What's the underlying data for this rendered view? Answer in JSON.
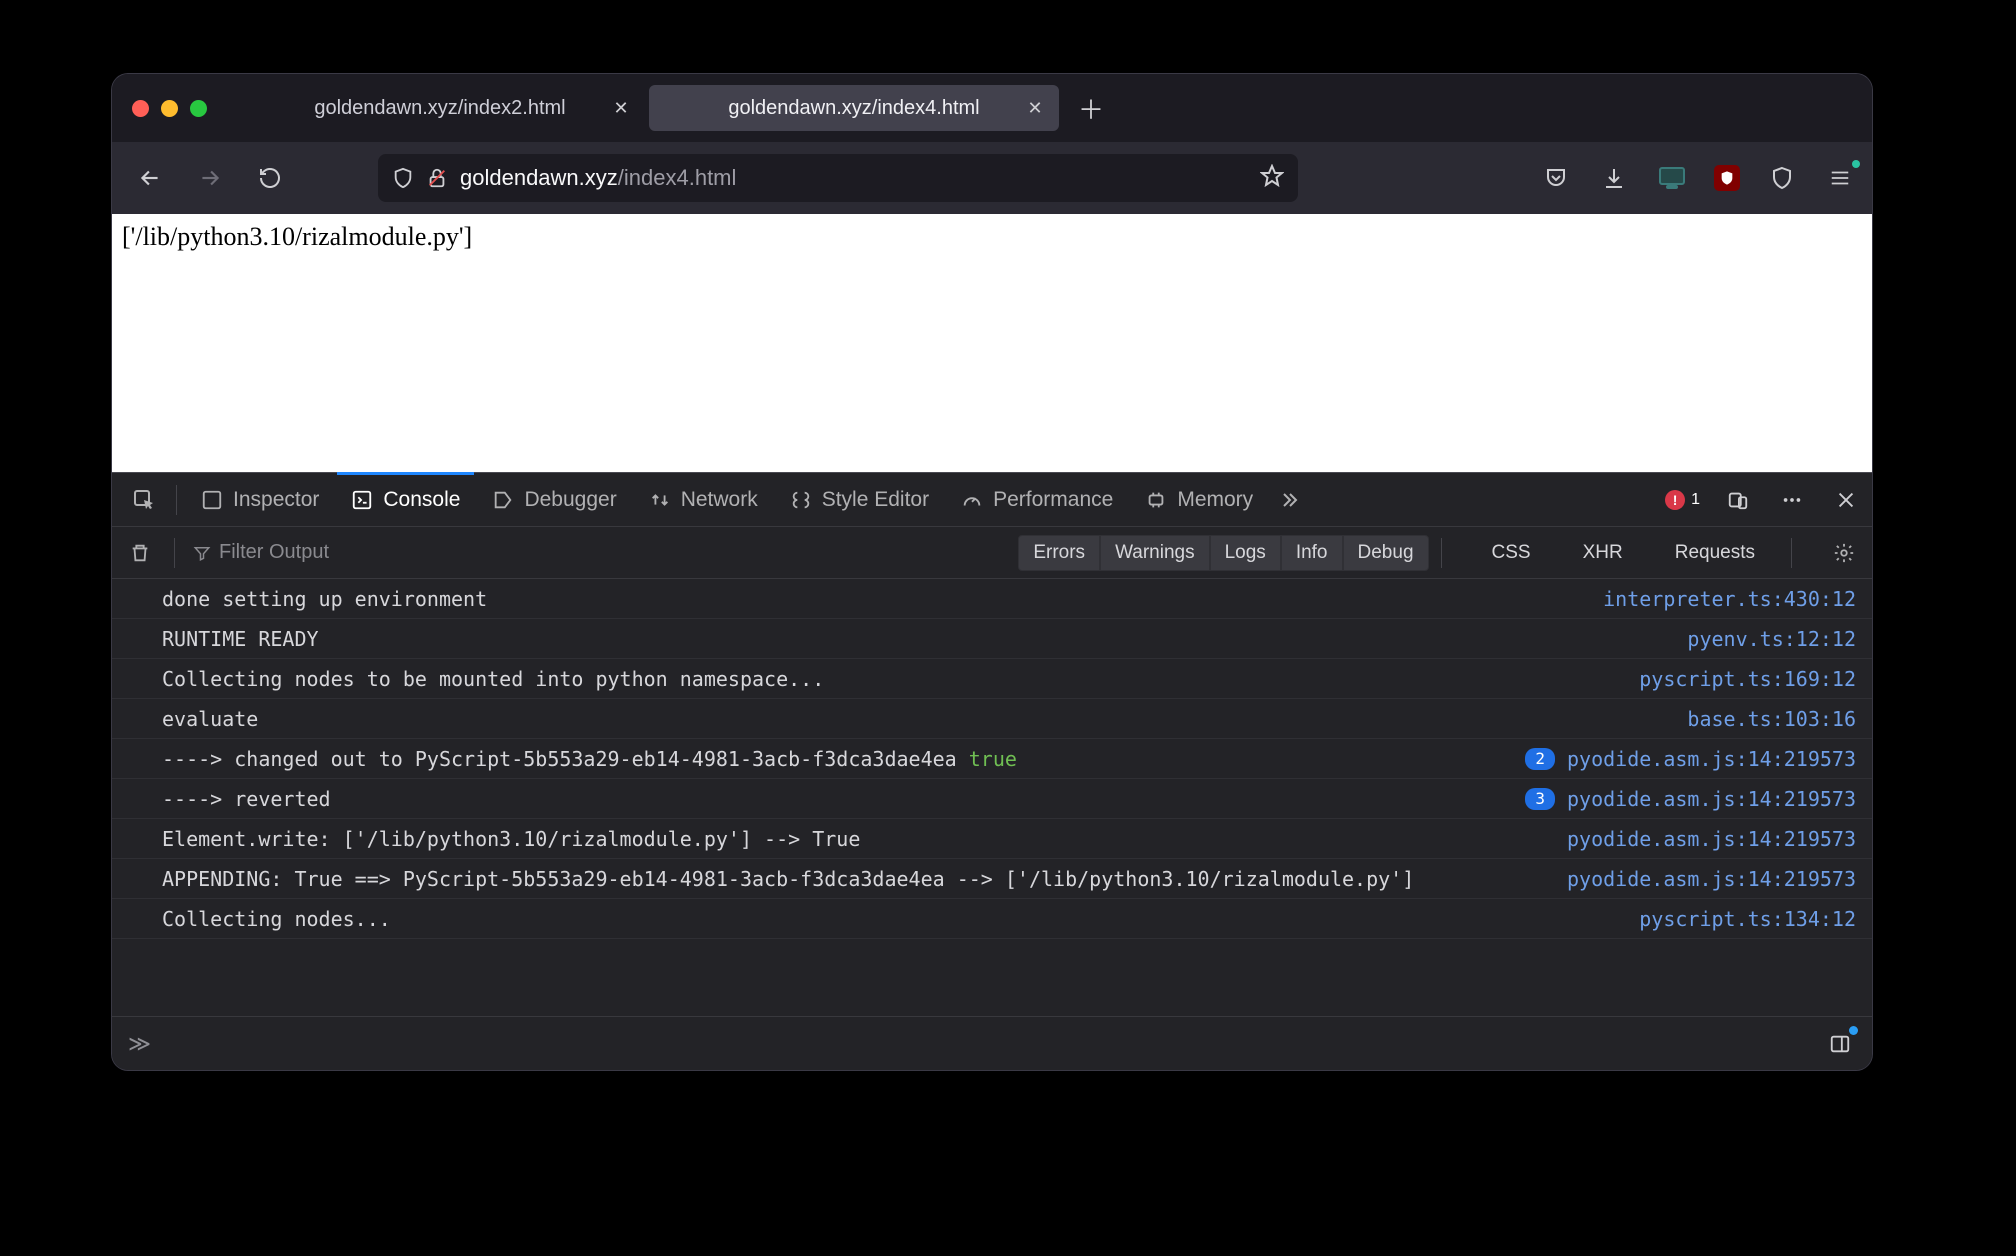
{
  "tabs": [
    {
      "title": "goldendawn.xyz/index2.html",
      "active": false
    },
    {
      "title": "goldendawn.xyz/index4.html",
      "active": true
    }
  ],
  "url": {
    "host": "goldendawn.xyz",
    "path": "/index4.html"
  },
  "page_text": "['/lib/python3.10/rizalmodule.py']",
  "devtools": {
    "tabs": [
      "Inspector",
      "Console",
      "Debugger",
      "Network",
      "Style Editor",
      "Performance",
      "Memory"
    ],
    "active_tab": "Console",
    "error_count": "1",
    "filter_placeholder": "Filter Output",
    "level_toggles": [
      "Errors",
      "Warnings",
      "Logs",
      "Info",
      "Debug"
    ],
    "extra_toggles": [
      "CSS",
      "XHR",
      "Requests"
    ]
  },
  "console_rows": [
    {
      "msg": "done setting up environment",
      "src": "interpreter.ts:430:12"
    },
    {
      "msg": "RUNTIME READY",
      "src": "pyenv.ts:12:12"
    },
    {
      "msg": "Collecting nodes to be mounted into python namespace...",
      "src": "pyscript.ts:169:12"
    },
    {
      "msg": "evaluate",
      "src": "base.ts:103:16"
    },
    {
      "msg_pre": "----> changed out to PyScript-5b553a29-eb14-4981-3acb-f3dca3dae4ea ",
      "msg_lit": "true",
      "count": "2",
      "src": "pyodide.asm.js:14:219573"
    },
    {
      "msg": "----> reverted",
      "count": "3",
      "src": "pyodide.asm.js:14:219573"
    },
    {
      "msg": "Element.write: ['/lib/python3.10/rizalmodule.py'] --> True",
      "src": "pyodide.asm.js:14:219573"
    },
    {
      "msg": "APPENDING: True ==> PyScript-5b553a29-eb14-4981-3acb-f3dca3dae4ea --> ['/lib/python3.10/rizalmodule.py']",
      "src": "pyodide.asm.js:14:219573"
    },
    {
      "msg": "Collecting nodes...",
      "src": "pyscript.ts:134:12"
    }
  ],
  "prompt": "≫"
}
